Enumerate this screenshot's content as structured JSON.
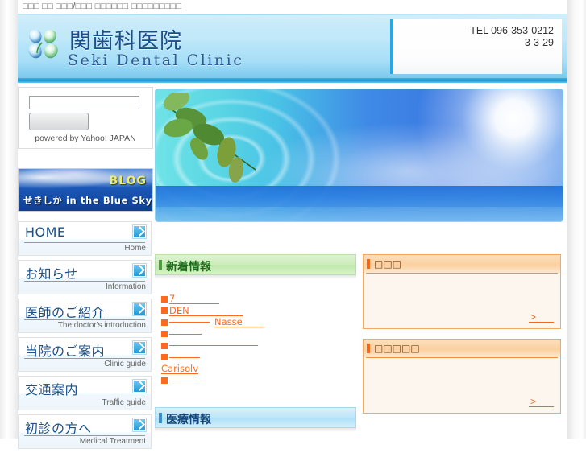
{
  "browser_title_strip": "□□□ □□ □□□/□□□ □□□□□□ □□□□□□□□□",
  "header": {
    "logo_jp": "関歯科医院",
    "logo_en": "Seki Dental Clinic",
    "tel": "TEL 096-353-0212",
    "address": "3-3-29"
  },
  "sidebar": {
    "search": {
      "input_value": "",
      "placeholder": "",
      "button_label": "",
      "credit": "powered by Yahoo! JAPAN"
    },
    "blog": {
      "badge": "BLOG",
      "title": "せきしか in the Blue Sky"
    },
    "nav": [
      {
        "jp": "HOME",
        "en": "Home",
        "arrow": "arrow-down-right-icon"
      },
      {
        "jp": "お知らせ",
        "en": "Information",
        "arrow": "arrow-down-right-icon"
      },
      {
        "jp": "医師のご紹介",
        "en": "The doctor's introduction",
        "arrow": "arrow-down-right-icon"
      },
      {
        "jp": "当院のご案内",
        "en": "Clinic guide",
        "arrow": "arrow-down-right-icon"
      },
      {
        "jp": "交通案内",
        "en": "Traffic guide",
        "arrow": "arrow-down-right-icon"
      },
      {
        "jp": "初診の方へ",
        "en": "Medical Treatment",
        "arrow": "arrow-down-right-icon"
      }
    ]
  },
  "main": {
    "news_panel": {
      "title": "新着情報",
      "items": [
        {
          "label": "7",
          "rule_width": 62,
          "indent": 0
        },
        {
          "label": "DEN",
          "rule_width": 92,
          "indent": 0
        },
        {
          "label": "",
          "rule_width": 50,
          "indent": 0,
          "label2": "Nasse",
          "rule2_width": 62
        },
        {
          "label": "",
          "rule_width": 40,
          "indent": 0
        },
        {
          "label": "",
          "rule_width": 110,
          "indent": 0
        },
        {
          "label": "",
          "rule_width": 38,
          "indent": 0
        },
        {
          "label": "Carisolv",
          "rule_width": 45,
          "indent": 0,
          "no_bullet": true
        },
        {
          "label": "",
          "rule_width": 38,
          "indent": 0
        }
      ]
    },
    "medical_panel": {
      "title": "医療情報"
    }
  },
  "right": {
    "panels": [
      {
        "title": "□□□",
        "more_label": ">"
      },
      {
        "title": "□□□□□",
        "more_label": ">"
      }
    ]
  },
  "colors": {
    "accent_blue": "#29a7e0",
    "header_blue": "#9bd9f5",
    "link_orange": "#ff6a1f",
    "panel_green": "#cdecbb",
    "panel_orange": "#fbd0a0",
    "nav_text": "#1a4f8a"
  }
}
